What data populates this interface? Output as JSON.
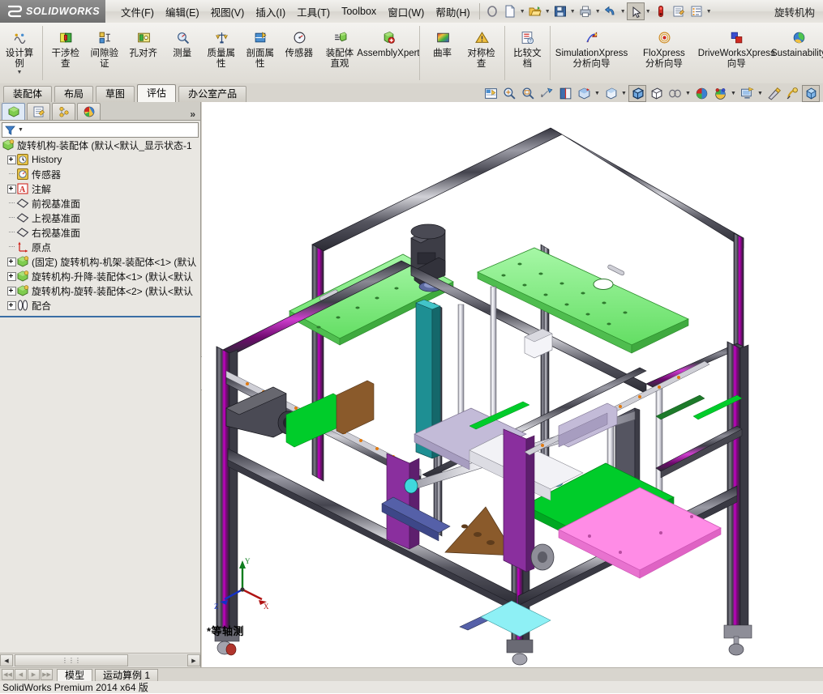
{
  "app": {
    "brand_ds": "3S",
    "brand_name": "SOLIDWORKS",
    "document_title": "旋转机构",
    "status_text": "SolidWorks Premium 2014 x64 版"
  },
  "menu": {
    "items": [
      {
        "label": "文件(F)",
        "name": "menu-file"
      },
      {
        "label": "编辑(E)",
        "name": "menu-edit"
      },
      {
        "label": "视图(V)",
        "name": "menu-view"
      },
      {
        "label": "插入(I)",
        "name": "menu-insert"
      },
      {
        "label": "工具(T)",
        "name": "menu-tools"
      },
      {
        "label": "Toolbox",
        "name": "menu-toolbox"
      },
      {
        "label": "窗口(W)",
        "name": "menu-window"
      },
      {
        "label": "帮助(H)",
        "name": "menu-help"
      }
    ]
  },
  "quickbar": {
    "items": [
      {
        "name": "pin-icon",
        "glyph": "pin",
        "caret": false
      },
      {
        "name": "new-document-icon",
        "glyph": "newdoc",
        "caret": true
      },
      {
        "name": "open-folder-icon",
        "glyph": "open",
        "caret": true
      },
      {
        "name": "save-icon",
        "glyph": "save",
        "caret": true
      },
      {
        "name": "print-icon",
        "glyph": "print",
        "caret": true
      },
      {
        "name": "undo-icon",
        "glyph": "undo",
        "caret": true
      },
      {
        "name": "select-pointer-icon",
        "glyph": "pointer",
        "caret": true,
        "selected": true
      },
      {
        "name": "rebuild-icon",
        "glyph": "rebuild",
        "caret": false
      },
      {
        "name": "options-icon",
        "glyph": "options",
        "caret": false
      },
      {
        "name": "list-properties-icon",
        "glyph": "list",
        "caret": true
      }
    ]
  },
  "ribbon": {
    "commands": [
      {
        "label": "设计算例",
        "name": "cmd-design-study",
        "icon": "design-study-icon",
        "dropdown": true,
        "group": 0
      },
      {
        "label": "干涉检查",
        "name": "cmd-interference-detection",
        "icon": "interference-icon",
        "group": 1
      },
      {
        "label": "间隙验证",
        "name": "cmd-clearance-verification",
        "icon": "clearance-icon",
        "group": 1
      },
      {
        "label": "孔对齐",
        "name": "cmd-hole-alignment",
        "icon": "hole-align-icon",
        "group": 1
      },
      {
        "label": "测量",
        "name": "cmd-measure",
        "icon": "measure-icon",
        "group": 1
      },
      {
        "label": "质量属性",
        "name": "cmd-mass-properties",
        "icon": "mass-properties-icon",
        "group": 1
      },
      {
        "label": "剖面属性",
        "name": "cmd-section-properties",
        "icon": "section-properties-icon",
        "group": 1
      },
      {
        "label": "传感器",
        "name": "cmd-sensor",
        "icon": "sensor-icon",
        "group": 1
      },
      {
        "label": "装配体直观",
        "name": "cmd-assembly-visualization",
        "icon": "assembly-visual-icon",
        "group": 1
      },
      {
        "label": "AssemblyXpert",
        "name": "cmd-assembly-xpert",
        "icon": "assembly-xpert-icon",
        "group": 1,
        "wide": true
      },
      {
        "label": "曲率",
        "name": "cmd-curvature",
        "icon": "curvature-icon",
        "group": 2
      },
      {
        "label": "对称检查",
        "name": "cmd-symmetry-check",
        "icon": "symmetry-check-icon",
        "group": 2
      },
      {
        "label": "比较文档",
        "name": "cmd-compare-documents",
        "icon": "compare-documents-icon",
        "group": 3
      },
      {
        "label": "SimulationXpress 分析向导",
        "name": "cmd-simulationxpress",
        "icon": "simulationxpress-icon",
        "group": 4,
        "wide": true
      },
      {
        "label": "FloXpress 分析向导",
        "name": "cmd-floxpress",
        "icon": "floxpress-icon",
        "group": 4,
        "wide": true
      },
      {
        "label": "DriveWorksXpress 向导",
        "name": "cmd-driveworksxpress",
        "icon": "driveworksxpress-icon",
        "group": 4,
        "wide": true
      },
      {
        "label": "Sustainability",
        "name": "cmd-sustainability",
        "icon": "sustainability-icon",
        "group": 4,
        "wide": true
      }
    ]
  },
  "command_tabs": {
    "items": [
      {
        "label": "装配体",
        "name": "tab-assembly",
        "active": false
      },
      {
        "label": "布局",
        "name": "tab-layout",
        "active": false
      },
      {
        "label": "草图",
        "name": "tab-sketch",
        "active": false
      },
      {
        "label": "评估",
        "name": "tab-evaluate",
        "active": true
      },
      {
        "label": "办公室产品",
        "name": "tab-office-products",
        "active": false
      }
    ]
  },
  "view_toolbar": {
    "items": [
      {
        "name": "view-orientation-icon",
        "glyph": "vo",
        "caret": false
      },
      {
        "name": "zoom-to-fit-icon",
        "glyph": "zfit",
        "caret": false
      },
      {
        "name": "zoom-to-area-icon",
        "glyph": "zarea",
        "caret": false
      },
      {
        "name": "previous-view-icon",
        "glyph": "prev",
        "caret": false
      },
      {
        "name": "section-view-icon",
        "glyph": "section",
        "caret": false
      },
      {
        "name": "view-orientation-cube-icon",
        "glyph": "orient",
        "caret": true
      },
      {
        "name": "display-style-icon",
        "glyph": "dstyle",
        "caret": true
      },
      {
        "name": "shaded-with-edges-icon",
        "glyph": "shadededge",
        "caret": false,
        "selected": true
      },
      {
        "name": "shaded-icon",
        "glyph": "shaded",
        "caret": false
      },
      {
        "name": "hide-show-items-icon",
        "glyph": "hideshow",
        "caret": true
      },
      {
        "name": "apply-scene-icon",
        "glyph": "scene",
        "caret": false
      },
      {
        "name": "view-settings-icon",
        "glyph": "vsettings",
        "caret": true
      },
      {
        "name": "display-manager-icon",
        "glyph": "dispmgr",
        "caret": true
      },
      {
        "name": "appearances-icon",
        "glyph": "appear",
        "caret": false
      },
      {
        "name": "edit-appearance-icon",
        "glyph": "editappear",
        "caret": false
      },
      {
        "name": "view-cube-icon",
        "glyph": "cube",
        "caret": false,
        "selected": true
      }
    ]
  },
  "tree_panel": {
    "tabs": [
      {
        "name": "feature-manager-tab",
        "glyph": "fm",
        "active": true
      },
      {
        "name": "property-manager-tab",
        "glyph": "pm",
        "active": false
      },
      {
        "name": "configuration-manager-tab",
        "glyph": "cm",
        "active": false
      },
      {
        "name": "display-manager-tab",
        "glyph": "dm",
        "active": false
      }
    ],
    "more_label": "»",
    "filter_placeholder": "",
    "nodes": [
      {
        "label": "旋转机构-装配体  (默认<默认_显示状态-1",
        "icon": "assembly-icon",
        "depth": 0,
        "expander": "none",
        "root": true
      },
      {
        "label": "History",
        "icon": "history-icon",
        "depth": 1,
        "expander": "plus"
      },
      {
        "label": "传感器",
        "icon": "sensors-icon",
        "depth": 1,
        "expander": "dot"
      },
      {
        "label": "注解",
        "icon": "annotations-icon",
        "depth": 1,
        "expander": "plus"
      },
      {
        "label": "前视基准面",
        "icon": "plane-icon",
        "depth": 1,
        "expander": "dot"
      },
      {
        "label": "上视基准面",
        "icon": "plane-icon",
        "depth": 1,
        "expander": "dot"
      },
      {
        "label": "右视基准面",
        "icon": "plane-icon",
        "depth": 1,
        "expander": "dot"
      },
      {
        "label": "原点",
        "icon": "origin-icon",
        "depth": 1,
        "expander": "dot"
      },
      {
        "label": "(固定) 旋转机构-机架-装配体<1>  (默认",
        "icon": "assembly-icon",
        "depth": 1,
        "expander": "plus"
      },
      {
        "label": "旋转机构-升降-装配体<1>  (默认<默认",
        "icon": "assembly-icon",
        "depth": 1,
        "expander": "plus"
      },
      {
        "label": "旋转机构-旋转-装配体<2>  (默认<默认",
        "icon": "assembly-icon",
        "depth": 1,
        "expander": "plus"
      },
      {
        "label": "配合",
        "icon": "mates-icon",
        "depth": 1,
        "expander": "plus"
      }
    ],
    "hscroll_thumb_label": "⋮⋮⋮"
  },
  "graphics": {
    "view_label": "*等轴测",
    "triad": {
      "x_label": "X",
      "y_label": "Y",
      "z_label": "Z",
      "x_color": "#b01414",
      "y_color": "#0e7d1e",
      "z_color": "#1230c8"
    },
    "background": "#ffffff",
    "model_colors": {
      "extrusion_dark": "#3b3b45",
      "extrusion_mid": "#6e6e78",
      "extrusion_light": "#b9b9c0",
      "magenta": "#b300b3",
      "pink": "#ff8ce6",
      "green_plate": "#7bee7b",
      "green_bright": "#00cc2a",
      "teal": "#1ba6a6",
      "orange": "#e07a10",
      "brown": "#8a5a2b",
      "purple": "#8a2f9e",
      "lavender": "#c3bbd8",
      "cyan": "#5fe5ea",
      "white_rod": "#ececf2",
      "motor_dark": "#43434b"
    }
  },
  "bottom": {
    "nav_buttons": [
      "first-sheet-button",
      "prev-sheet-button",
      "next-sheet-button",
      "last-sheet-button"
    ],
    "tabs": [
      {
        "label": "模型",
        "name": "bottom-tab-model",
        "active": true
      },
      {
        "label": "运动算例 1",
        "name": "bottom-tab-motion-study",
        "active": false
      }
    ]
  }
}
